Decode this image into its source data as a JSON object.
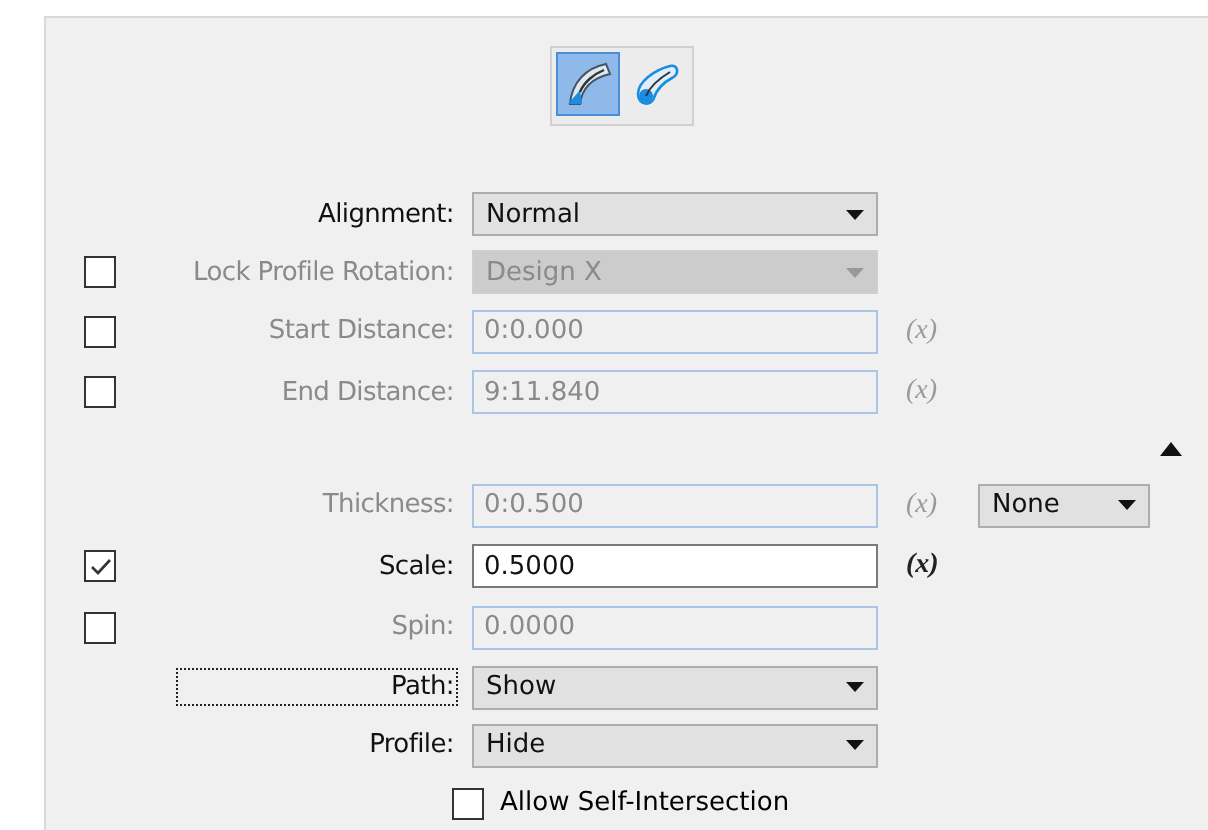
{
  "mode_buttons": [
    {
      "kind": "arc",
      "selected": true
    },
    {
      "kind": "path",
      "selected": false
    }
  ],
  "rows": [
    {
      "kind": "dropdown",
      "label": "Alignment:",
      "value": "Normal",
      "disabled": false
    },
    {
      "kind": "dropdown",
      "label": "Lock Profile Rotation:",
      "value": "Design X",
      "disabled": true,
      "checked": false
    },
    {
      "kind": "text",
      "label": "Start Distance:",
      "value": "0:0.000",
      "disabled": true,
      "checked": false,
      "expression": "(x)"
    },
    {
      "kind": "text",
      "label": "End Distance:",
      "value": "9:11.840",
      "disabled": true,
      "checked": false,
      "expression": "(x)"
    },
    {
      "kind": "collapse",
      "expanded": true
    },
    {
      "kind": "text",
      "label": "Thickness:",
      "value": "0:0.500",
      "disabled": true,
      "expression": "(x)",
      "extra": "None"
    },
    {
      "kind": "text",
      "label": "Scale:",
      "value": "0.5000",
      "disabled": false,
      "checked": true,
      "expression": "(x)"
    },
    {
      "kind": "text",
      "label": "Spin:",
      "value": "0.0000",
      "disabled": true,
      "checked": false
    },
    {
      "kind": "dropdown",
      "label": "Path:",
      "value": "Show",
      "disabled": false,
      "focused": true
    },
    {
      "kind": "dropdown",
      "label": "Profile:",
      "value": "Hide",
      "disabled": false
    },
    {
      "kind": "option",
      "label": "Allow Self-Intersection",
      "checked": false
    }
  ]
}
